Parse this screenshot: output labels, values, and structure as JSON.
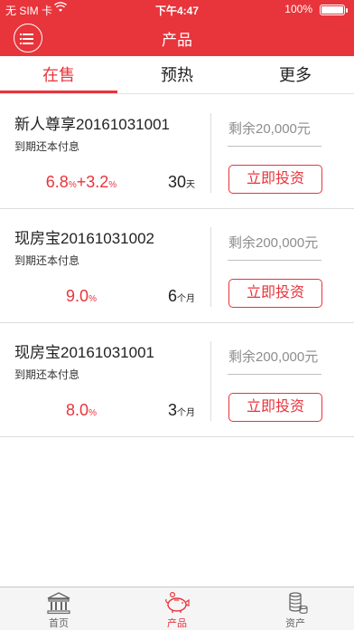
{
  "status_bar": {
    "carrier": "无 SIM 卡",
    "time": "下午4:47",
    "battery": "100%"
  },
  "header": {
    "title": "产品"
  },
  "tabs": [
    {
      "label": "在售",
      "active": true
    },
    {
      "label": "预热",
      "active": false
    },
    {
      "label": "更多",
      "active": false
    }
  ],
  "products": [
    {
      "name": "新人尊享20161031001",
      "desc": "到期还本付息",
      "rate_main": "6.8",
      "rate_unit": "%",
      "rate_extra": "+3.2",
      "rate_extra_unit": "%",
      "term": "30",
      "term_unit": "天",
      "remain": "剩余20,000元",
      "button": "立即投资"
    },
    {
      "name": "现房宝20161031002",
      "desc": "到期还本付息",
      "rate_main": "9.0",
      "rate_unit": "%",
      "term": "6",
      "term_unit": "个月",
      "remain": "剩余200,000元",
      "button": "立即投资"
    },
    {
      "name": "现房宝20161031001",
      "desc": "到期还本付息",
      "rate_main": "8.0",
      "rate_unit": "%",
      "term": "3",
      "term_unit": "个月",
      "remain": "剩余200,000元",
      "button": "立即投资"
    }
  ],
  "bottom_nav": [
    {
      "label": "首页",
      "icon": "bank-icon",
      "active": false
    },
    {
      "label": "产品",
      "icon": "piggy-bank-icon",
      "active": true
    },
    {
      "label": "资产",
      "icon": "coins-icon",
      "active": false
    }
  ],
  "colors": {
    "accent": "#e8343b",
    "divider": "#dcdcdc",
    "muted_text": "#8d8d8d"
  }
}
